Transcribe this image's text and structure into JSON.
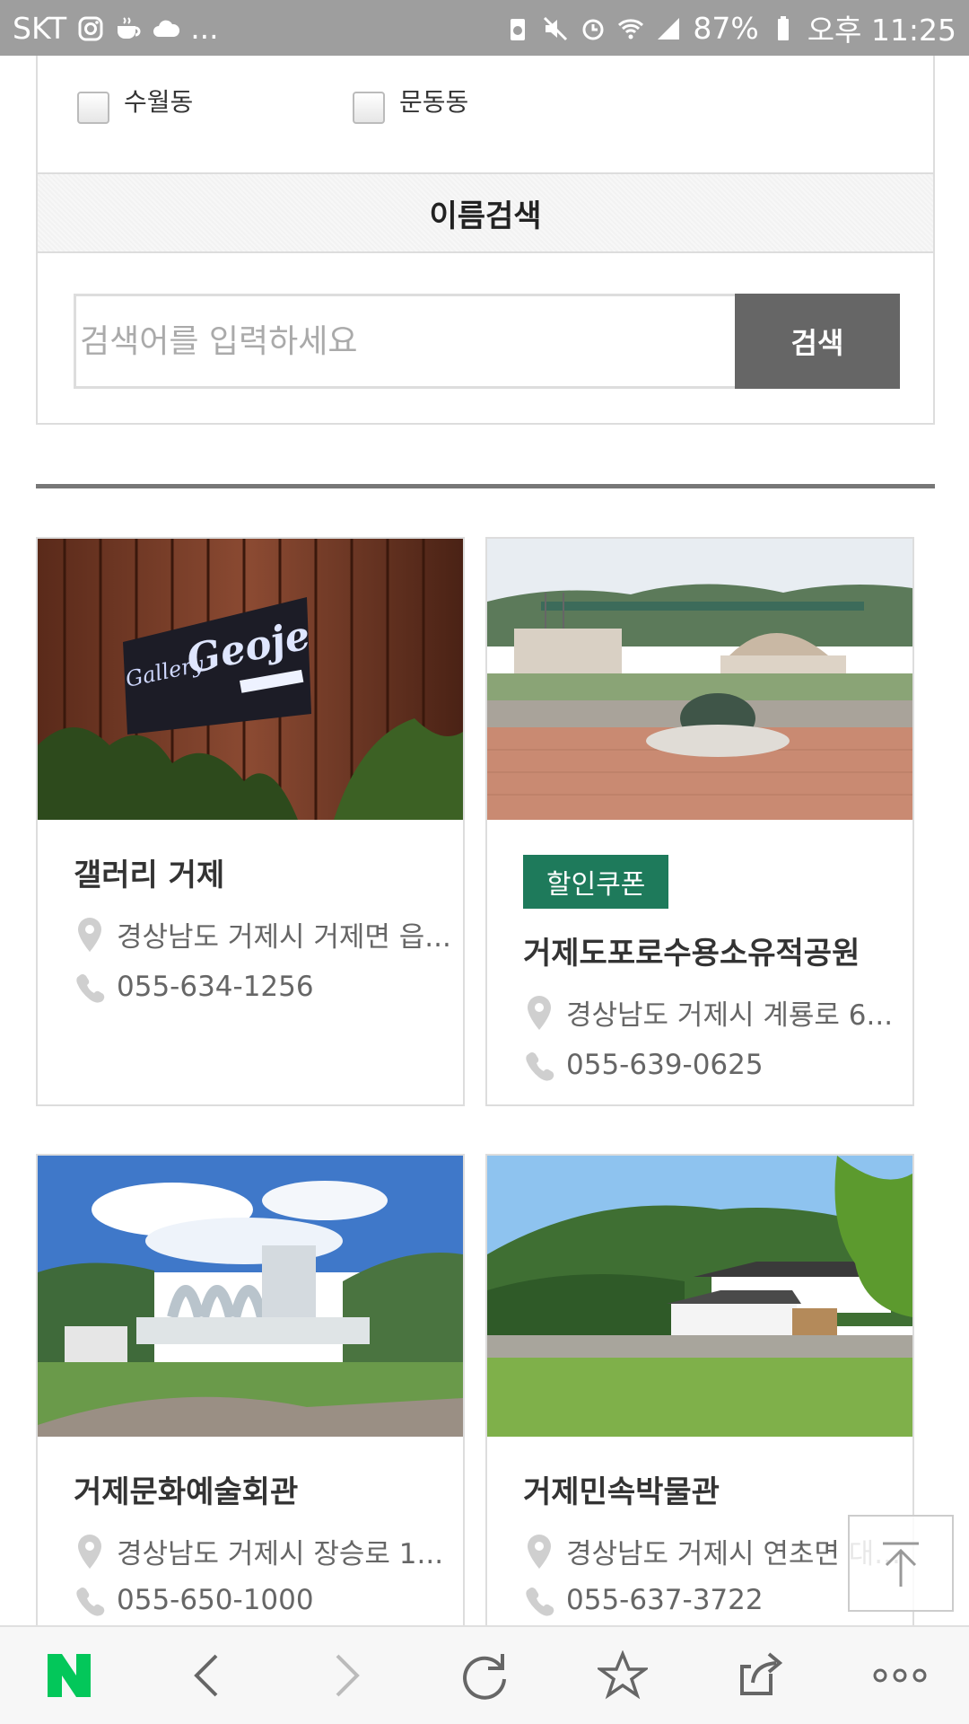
{
  "status_bar": {
    "carrier": "SKT",
    "left_icons": [
      "instagram-icon",
      "coffee-icon",
      "cloud-icon"
    ],
    "overflow": "...",
    "battery": "87%",
    "time": "오후 11:25"
  },
  "filters": {
    "checkboxes": [
      {
        "label": "수월동",
        "checked": false
      },
      {
        "label": "문동동",
        "checked": false
      }
    ]
  },
  "name_search": {
    "heading": "이름검색",
    "placeholder": "검색어를 입력하세요",
    "value": "",
    "button_label": "검색"
  },
  "cards": [
    {
      "title": "갤러리 거제",
      "coupon": "",
      "address": "경상남도 거제시 거제면 읍...",
      "phone": "055-634-1256",
      "photo": "gallery-sign-photo"
    },
    {
      "title": "거제도포로수용소유적공원",
      "coupon": "할인쿠폰",
      "address": "경상남도 거제시 계룡로 6...",
      "phone": "055-639-0625",
      "photo": "pow-camp-park-photo"
    },
    {
      "title": "거제문화예술회관",
      "coupon": "",
      "address": "경상남도 거제시 장승로 1...",
      "phone": "055-650-1000",
      "photo": "art-center-photo"
    },
    {
      "title": "거제민속박물관",
      "coupon": "",
      "address": "경상남도 거제시 연초면 대...",
      "phone": "055-637-3722",
      "photo": "folk-museum-photo"
    }
  ],
  "sign_text": {
    "gallery": "Gallery",
    "geoje": "Geoje"
  },
  "colors": {
    "coupon": "#1e7a5b",
    "search_button": "#666666",
    "naver_green": "#03c75a"
  },
  "bottom_nav": [
    "naver-icon",
    "back-icon",
    "forward-icon",
    "refresh-icon",
    "bookmark-icon",
    "share-icon",
    "more-icon"
  ]
}
